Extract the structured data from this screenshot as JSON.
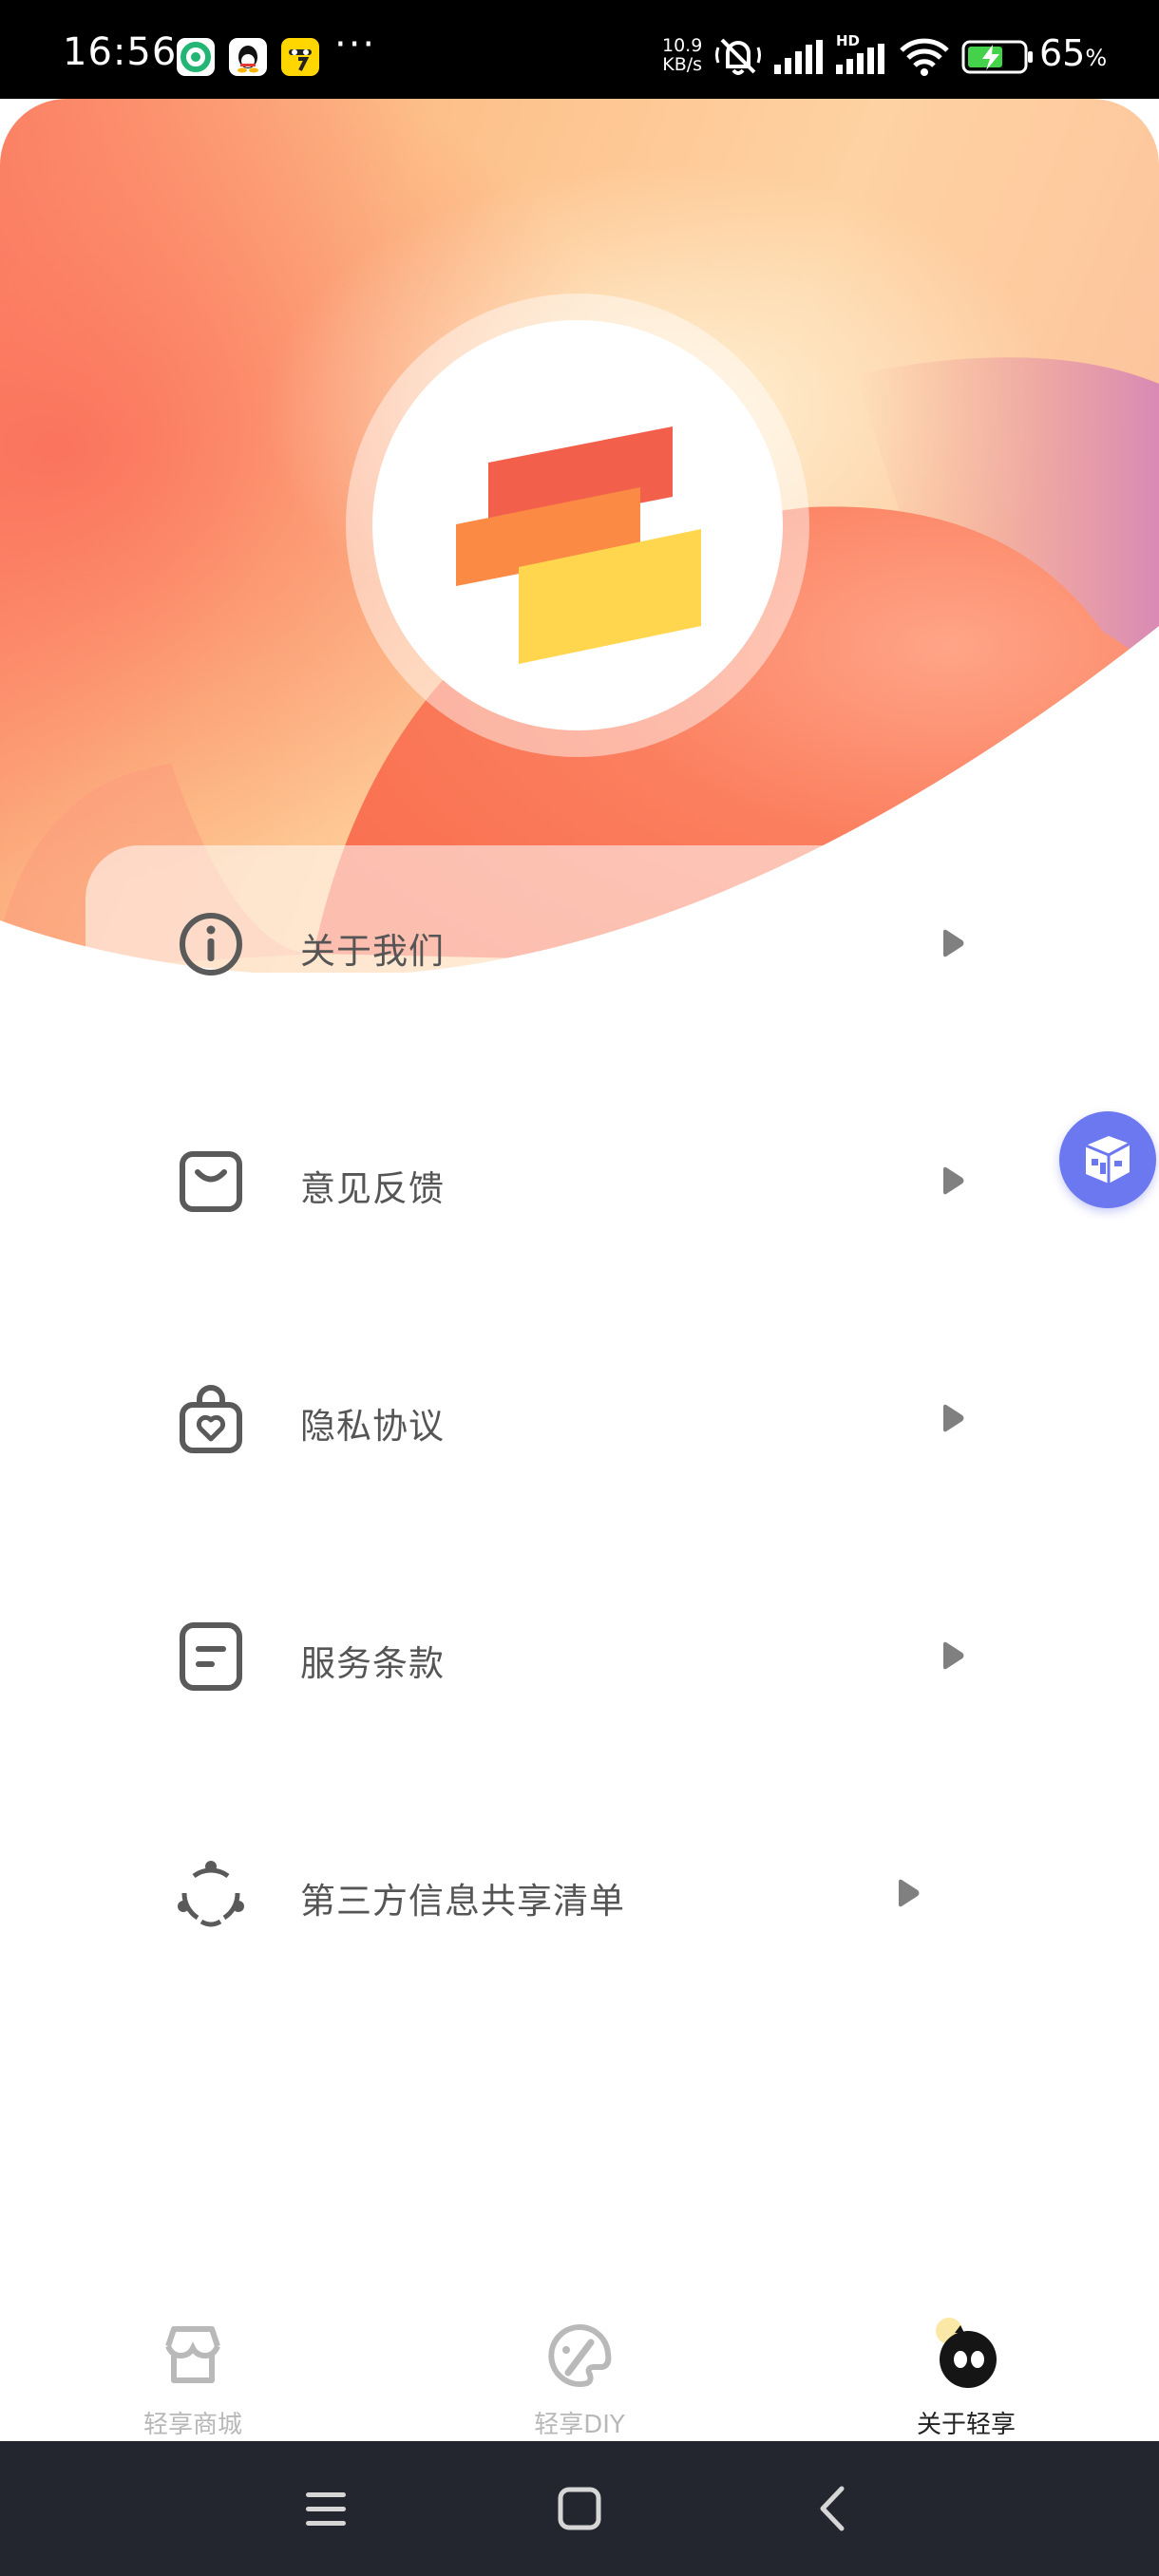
{
  "status_bar": {
    "time": "16:56",
    "more_dots": "···",
    "net_speed_value": "10.9",
    "net_speed_unit": "KB/s",
    "network_type": "HD",
    "battery_percent": "65",
    "battery_unit": "%",
    "battery_level": 0.65,
    "app_icons": [
      "green-app-icon",
      "qq-icon",
      "yellow-app-icon"
    ]
  },
  "hero": {
    "logo": "qingxiang-logo",
    "colors": {
      "red": "#f2604c",
      "orange": "#fb8a45",
      "yellow": "#ffd64d"
    }
  },
  "menu": {
    "items": [
      {
        "label": "关于我们",
        "icon": "info-icon"
      },
      {
        "label": "意见反馈",
        "icon": "feedback-icon"
      },
      {
        "label": "隐私协议",
        "icon": "privacy-icon"
      },
      {
        "label": "服务条款",
        "icon": "terms-icon"
      },
      {
        "label": "第三方信息共享清单",
        "icon": "share-list-icon"
      }
    ]
  },
  "float_button": {
    "icon": "cube-icon",
    "color": "#6c78f0"
  },
  "tabs": [
    {
      "label": "轻享商城",
      "icon": "shop-icon",
      "active": false
    },
    {
      "label": "轻享DIY",
      "icon": "palette-icon",
      "active": false
    },
    {
      "label": "关于轻享",
      "icon": "mascot-icon",
      "active": true
    }
  ],
  "nav_bar": {
    "buttons": [
      "menu-icon",
      "home-icon",
      "back-icon"
    ]
  }
}
